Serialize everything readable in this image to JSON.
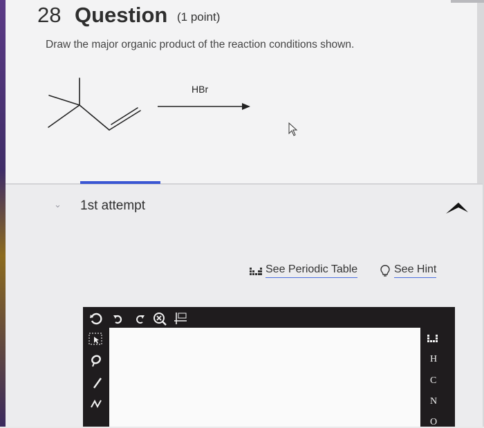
{
  "question": {
    "number": "28",
    "title": "Question",
    "points": "(1 point)",
    "instruction": "Draw the major organic product of the reaction conditions shown."
  },
  "reaction": {
    "reagent": "HBr"
  },
  "attempt": {
    "label": "1st attempt"
  },
  "links": {
    "periodic_table": "See Periodic Table",
    "hint": "See Hint"
  },
  "editor": {
    "toolbar_icons": [
      "clear-icon",
      "undo-icon",
      "redo-icon",
      "zoom-icon",
      "2d-icon"
    ],
    "left_tools": [
      "select-icon",
      "lasso-icon",
      "single-bond-icon",
      "chain-icon"
    ],
    "elements": [
      "H",
      "C",
      "N",
      "O"
    ]
  },
  "colors": {
    "accent": "#3a56d3",
    "editor_dark": "#1f1c1e"
  }
}
